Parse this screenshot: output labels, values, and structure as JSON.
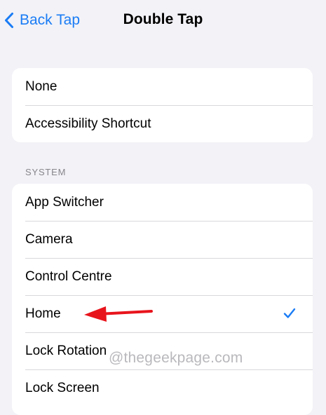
{
  "navbar": {
    "back_label": "Back Tap",
    "title": "Double Tap"
  },
  "top_group": {
    "items": [
      {
        "label": "None"
      },
      {
        "label": "Accessibility Shortcut"
      }
    ]
  },
  "system_section": {
    "header": "SYSTEM",
    "items": [
      {
        "label": "App Switcher"
      },
      {
        "label": "Camera"
      },
      {
        "label": "Control Centre"
      },
      {
        "label": "Home",
        "selected": true
      },
      {
        "label": "Lock Rotation"
      },
      {
        "label": "Lock Screen"
      }
    ]
  },
  "annotation": {
    "arrow_color": "#e8141c",
    "arrow_target": "Home"
  },
  "watermark": "@thegeekpage.com",
  "colors": {
    "accent": "#1a7cf5",
    "background": "#f2f2f7",
    "section_header": "#86868b"
  },
  "icons": {
    "back": "chevron-left-icon",
    "selected": "checkmark-icon"
  }
}
